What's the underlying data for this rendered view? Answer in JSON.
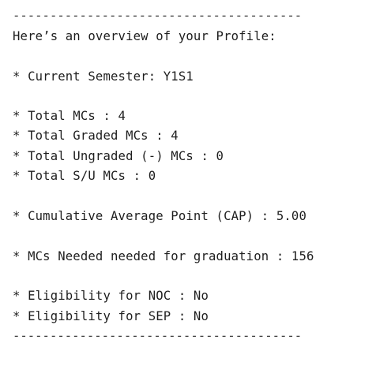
{
  "profile_summary": {
    "divider_top": "---------------------------------------",
    "heading": "Here’s an overview of your Profile:",
    "current_semester": "* Current Semester: Y1S1",
    "total_mcs": "* Total MCs : 4",
    "total_graded_mcs": "* Total Graded MCs : 4",
    "total_ungraded_mcs": "* Total Ungraded (-) MCs : 0",
    "total_su_mcs": "* Total S/U MCs : 0",
    "cap": "* Cumulative Average Point (CAP) : 5.00",
    "mcs_needed": "* MCs Needed needed for graduation : 156",
    "noc_eligibility": "* Eligibility for NOC : No",
    "sep_eligibility": "* Eligibility for SEP : No",
    "divider_bottom": "---------------------------------------"
  }
}
